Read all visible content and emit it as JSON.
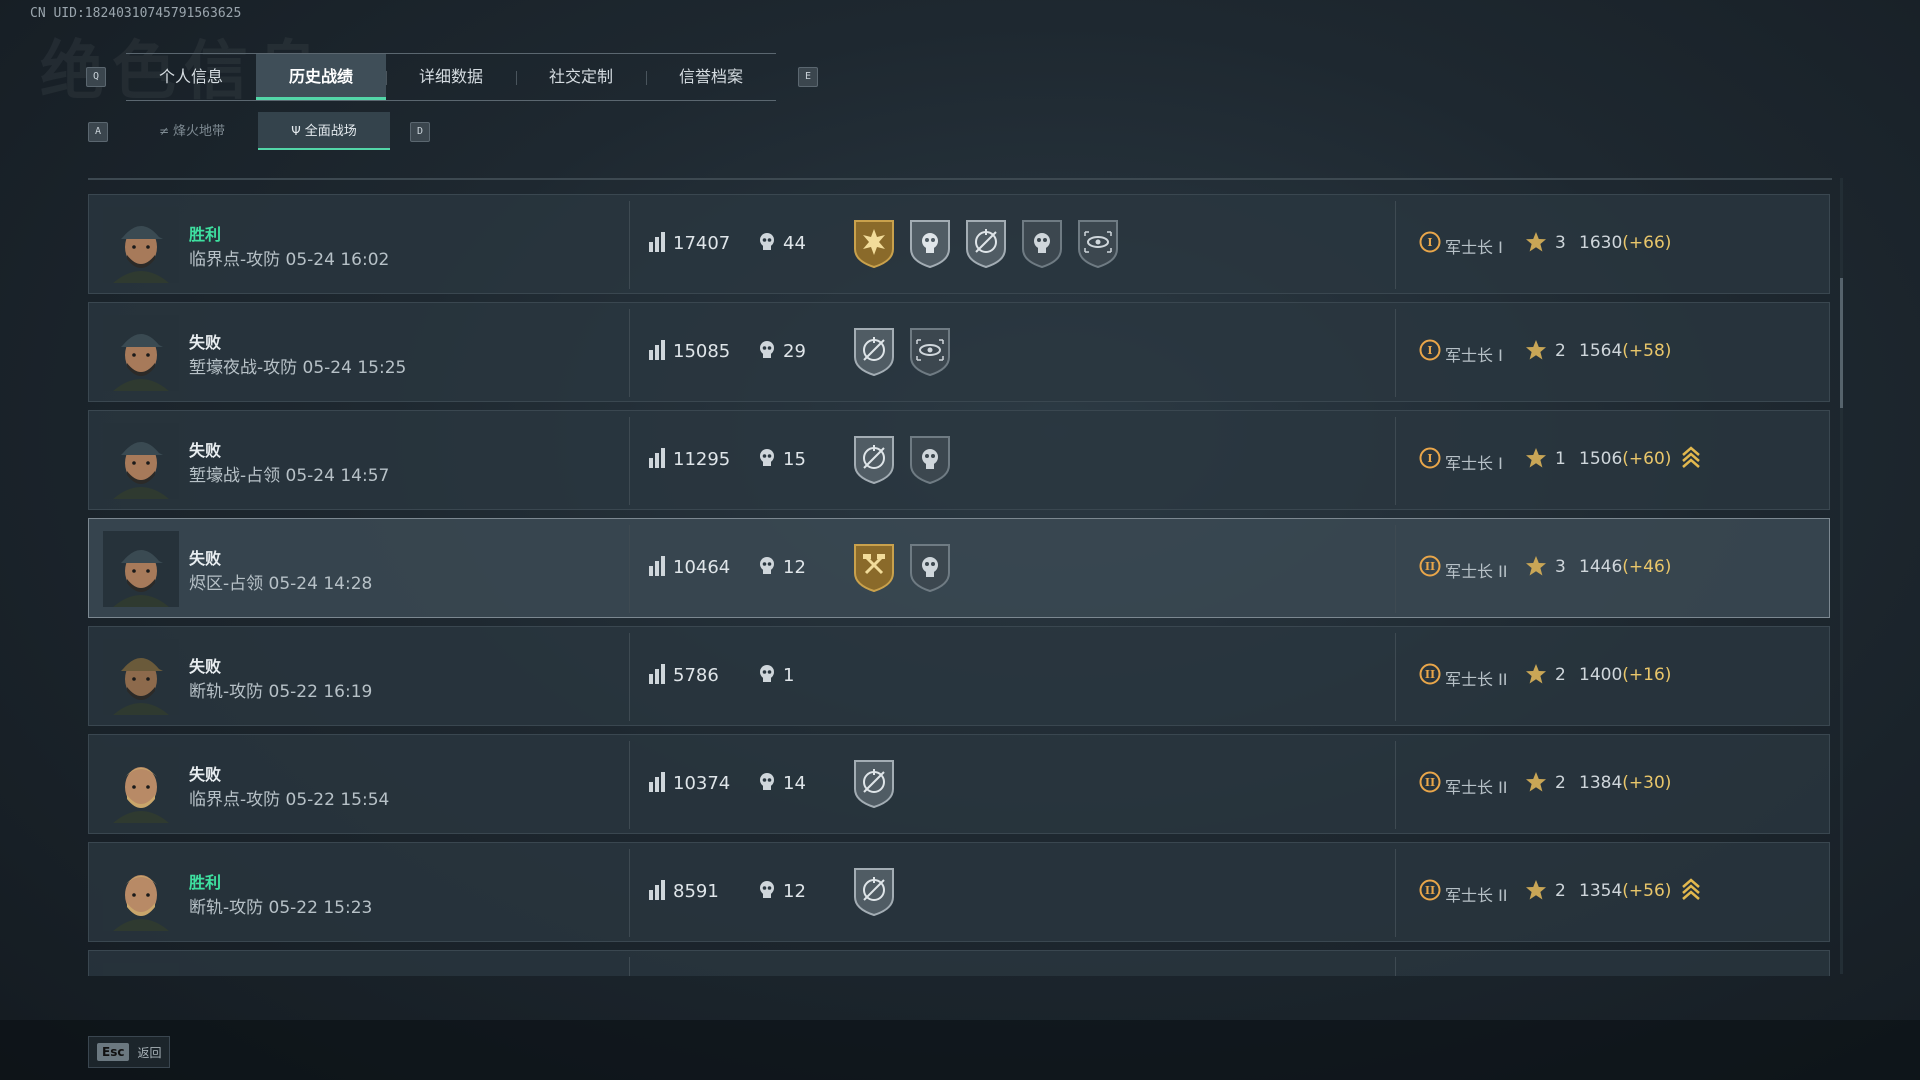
{
  "uid": "CN UID:18240310745791563625",
  "bg_title": "绝色信息",
  "keys": {
    "prev_tab": "Q",
    "next_tab": "E",
    "prev_sub": "A",
    "next_sub": "D"
  },
  "tabs": [
    "个人信息",
    "历史战绩",
    "详细数据",
    "社交定制",
    "信誉档案"
  ],
  "active_tab": 1,
  "subtabs": [
    {
      "label": "烽火地带",
      "icon": "≠"
    },
    {
      "label": "全面战场",
      "icon": "Ψ"
    }
  ],
  "active_subtab": 1,
  "matches": [
    {
      "result": "胜利",
      "win": true,
      "map": "临界点-攻防 05-24 16:02",
      "score": "17407",
      "kills": "44",
      "medals": [
        "gold-burst",
        "silver-skull",
        "silver-crosshair",
        "dark-skull",
        "dark-eye"
      ],
      "rank_icon": "I",
      "rank": "军士长 I",
      "stars": "3",
      "points": "1630",
      "delta": "(+66)",
      "chevron": false,
      "avatar": "cap"
    },
    {
      "result": "失败",
      "win": false,
      "map": "堑壕夜战-攻防 05-24 15:25",
      "score": "15085",
      "kills": "29",
      "medals": [
        "silver-crosshair",
        "dark-eye"
      ],
      "rank_icon": "I",
      "rank": "军士长 I",
      "stars": "2",
      "points": "1564",
      "delta": "(+58)",
      "chevron": false,
      "avatar": "cap"
    },
    {
      "result": "失败",
      "win": false,
      "map": "堑壕战-占领 05-24 14:57",
      "score": "11295",
      "kills": "15",
      "medals": [
        "silver-crosshair",
        "dark-skull"
      ],
      "rank_icon": "I",
      "rank": "军士长 I",
      "stars": "1",
      "points": "1506",
      "delta": "(+60)",
      "chevron": true,
      "avatar": "cap"
    },
    {
      "result": "失败",
      "win": false,
      "map": "烬区-占领 05-24 14:28",
      "score": "10464",
      "kills": "12",
      "medals": [
        "gold-hammer",
        "dark-skull"
      ],
      "rank_icon": "II",
      "rank": "军士长 II",
      "stars": "3",
      "points": "1446",
      "delta": "(+46)",
      "chevron": false,
      "avatar": "cap",
      "selected": true
    },
    {
      "result": "失败",
      "win": false,
      "map": "断轨-攻防 05-22 16:19",
      "score": "5786",
      "kills": "1",
      "medals": [],
      "rank_icon": "II",
      "rank": "军士长 II",
      "stars": "2",
      "points": "1400",
      "delta": "(+16)",
      "chevron": false,
      "avatar": "helmet"
    },
    {
      "result": "失败",
      "win": false,
      "map": "临界点-攻防 05-22 15:54",
      "score": "10374",
      "kills": "14",
      "medals": [
        "silver-crosshair"
      ],
      "rank_icon": "II",
      "rank": "军士长 II",
      "stars": "2",
      "points": "1384",
      "delta": "(+30)",
      "chevron": false,
      "avatar": "blond"
    },
    {
      "result": "胜利",
      "win": true,
      "map": "断轨-攻防 05-22 15:23",
      "score": "8591",
      "kills": "12",
      "medals": [
        "silver-crosshair"
      ],
      "rank_icon": "II",
      "rank": "军士长 II",
      "stars": "2",
      "points": "1354",
      "delta": "(+56)",
      "chevron": true,
      "avatar": "blond"
    },
    {
      "result": "",
      "win": false,
      "map": "",
      "score": "",
      "kills": "",
      "medals": [],
      "rank_icon": "",
      "rank": "",
      "stars": "",
      "points": "",
      "delta": "",
      "chevron": false,
      "avatar": "helmet",
      "partial": true
    }
  ],
  "footer": {
    "key": "Esc",
    "label": "返回"
  },
  "colors": {
    "accent": "#53d6a8",
    "win": "#3ee0a0",
    "gold": "#e9c66a"
  }
}
